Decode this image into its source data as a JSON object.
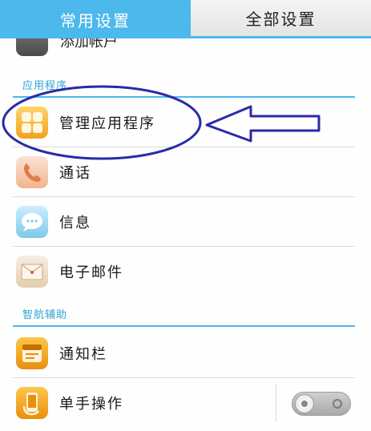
{
  "tabs": {
    "common": "常用设置",
    "all": "全部设置"
  },
  "partial_row": {
    "label": "添加帐户",
    "icon": "account-icon"
  },
  "sections": [
    {
      "title": "应用程序"
    },
    {
      "title": "智航辅助"
    }
  ],
  "rows": {
    "manage_apps": {
      "label": "管理应用程序",
      "icon": "apps-grid-icon"
    },
    "call": {
      "label": "通话",
      "icon": "phone-icon"
    },
    "messages": {
      "label": "信息",
      "icon": "chat-bubble-icon"
    },
    "email": {
      "label": "电子邮件",
      "icon": "envelope-icon"
    },
    "notification_bar": {
      "label": "通知栏",
      "icon": "notification-icon"
    },
    "one_hand": {
      "label": "单手操作",
      "icon": "phone-hand-icon",
      "toggle_on": false
    }
  },
  "colors": {
    "accent": "#4cb8ec",
    "annotation": "#2a2aa8"
  }
}
